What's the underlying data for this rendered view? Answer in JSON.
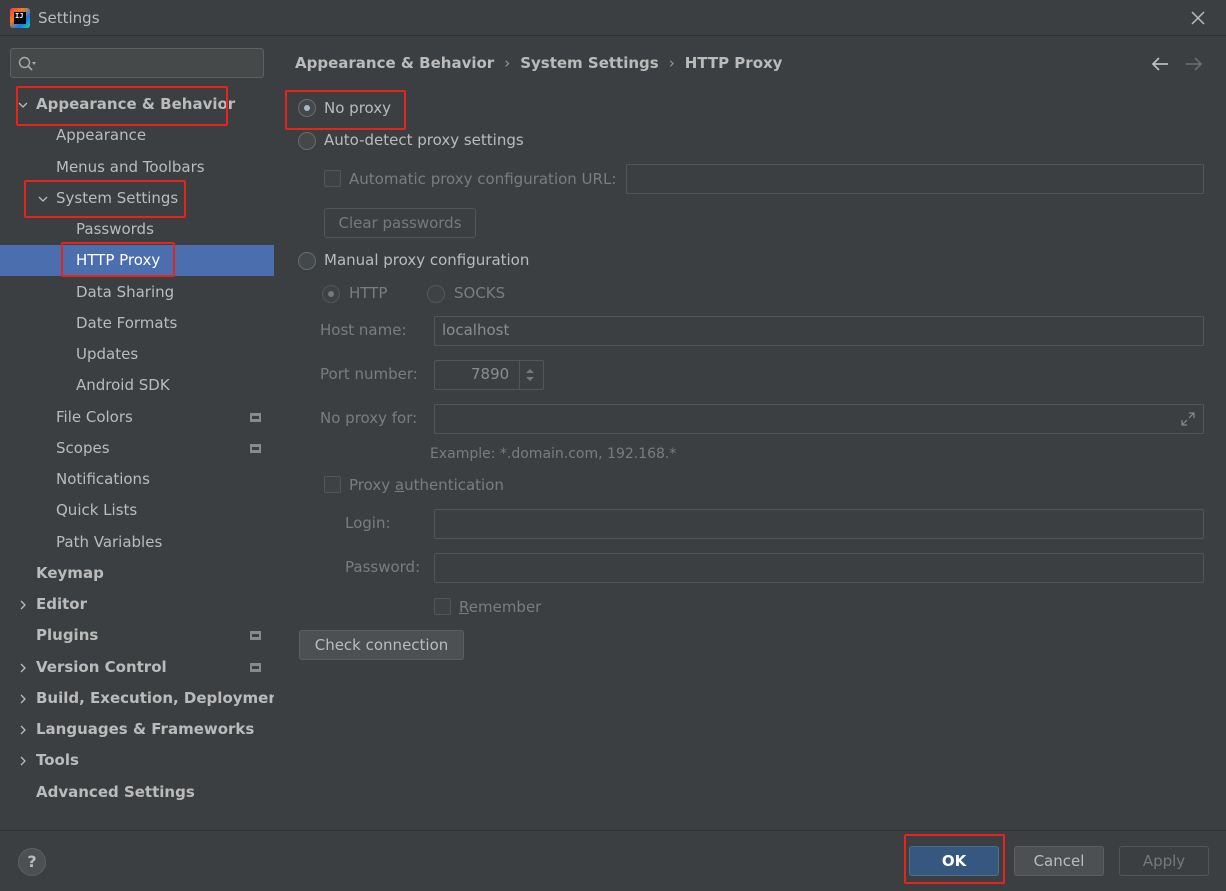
{
  "window": {
    "title": "Settings",
    "app_icon_text": "IJ"
  },
  "search": {
    "placeholder": ""
  },
  "sidebar": {
    "items": [
      {
        "label": "Appearance & Behavior"
      },
      {
        "label": "Appearance"
      },
      {
        "label": "Menus and Toolbars"
      },
      {
        "label": "System Settings"
      },
      {
        "label": "Passwords"
      },
      {
        "label": "HTTP Proxy"
      },
      {
        "label": "Data Sharing"
      },
      {
        "label": "Date Formats"
      },
      {
        "label": "Updates"
      },
      {
        "label": "Android SDK"
      },
      {
        "label": "File Colors"
      },
      {
        "label": "Scopes"
      },
      {
        "label": "Notifications"
      },
      {
        "label": "Quick Lists"
      },
      {
        "label": "Path Variables"
      },
      {
        "label": "Keymap"
      },
      {
        "label": "Editor"
      },
      {
        "label": "Plugins"
      },
      {
        "label": "Version Control"
      },
      {
        "label": "Build, Execution, Deployment"
      },
      {
        "label": "Languages & Frameworks"
      },
      {
        "label": "Tools"
      },
      {
        "label": "Advanced Settings"
      }
    ]
  },
  "breadcrumb": [
    "Appearance & Behavior",
    "System Settings",
    "HTTP Proxy"
  ],
  "proxy": {
    "no_proxy": "No proxy",
    "auto_detect": "Auto-detect proxy settings",
    "auto_config_url": "Automatic proxy configuration URL:",
    "clear_passwords": "Clear passwords",
    "manual": "Manual proxy configuration",
    "http": "HTTP",
    "socks": "SOCKS",
    "host_label": "Host name:",
    "host_value": "localhost",
    "port_label": "Port number:",
    "port_value": "7890",
    "no_proxy_for_label": "No proxy for:",
    "example": "Example: *.domain.com, 192.168.*",
    "auth_pre": "Proxy ",
    "auth_u": "a",
    "auth_post": "uthentication",
    "login_label": "Login:",
    "password_label": "Password:",
    "remember_u": "R",
    "remember_post": "emember",
    "check_connection": "Check connection"
  },
  "footer": {
    "help": "?",
    "ok": "OK",
    "cancel": "Cancel",
    "apply": "Apply"
  },
  "colors": {
    "accent": "#4b6eaf",
    "highlight": "#e5241b",
    "background": "#3c3f41",
    "primary_button": "#365880"
  }
}
